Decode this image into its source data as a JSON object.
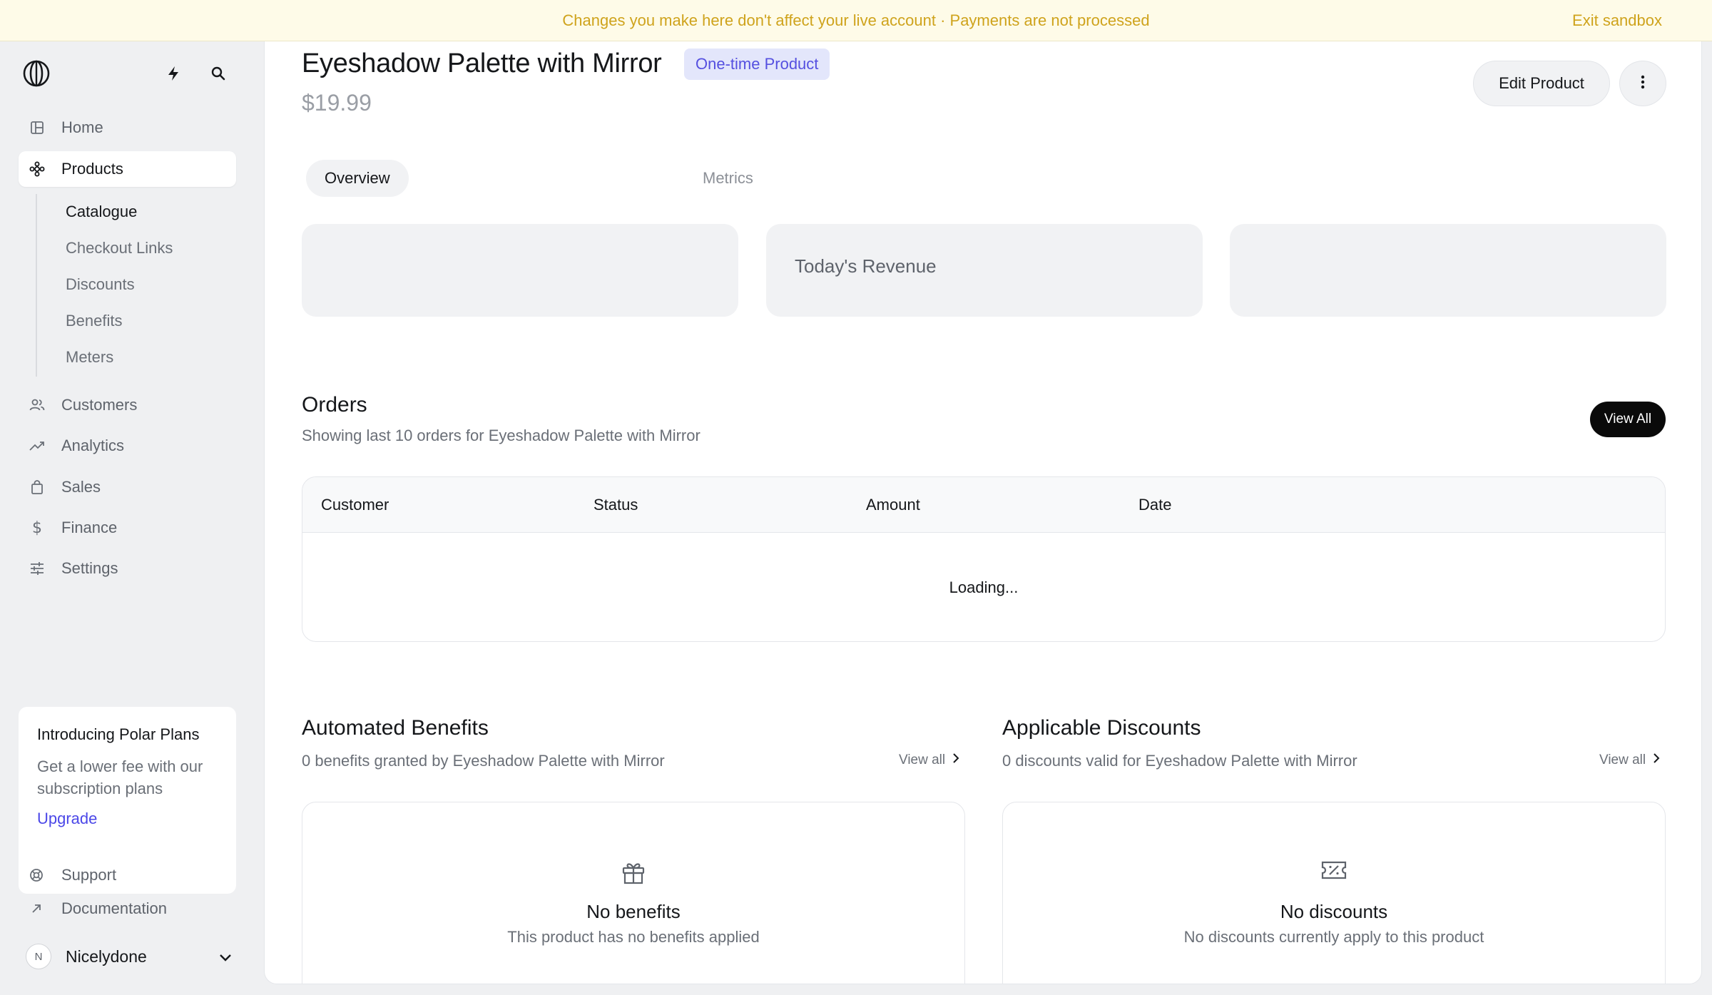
{
  "banner": {
    "message": "Changes you make here don't affect your live account · Payments are not processed",
    "exit_label": "Exit sandbox"
  },
  "sidebar": {
    "nav": [
      {
        "label": "Home",
        "icon": "home-icon"
      },
      {
        "label": "Products",
        "icon": "products-icon",
        "active": true
      },
      {
        "label": "Customers",
        "icon": "customers-icon"
      },
      {
        "label": "Analytics",
        "icon": "analytics-icon"
      },
      {
        "label": "Sales",
        "icon": "shopping-bag-icon"
      },
      {
        "label": "Finance",
        "icon": "dollar-icon"
      },
      {
        "label": "Settings",
        "icon": "sliders-icon"
      }
    ],
    "subnav": [
      {
        "label": "Catalogue",
        "active": true
      },
      {
        "label": "Checkout Links"
      },
      {
        "label": "Discounts"
      },
      {
        "label": "Benefits"
      },
      {
        "label": "Meters"
      }
    ],
    "promo": {
      "title": "Introducing Polar Plans",
      "description": "Get a lower fee with our subscription plans",
      "link": "Upgrade"
    },
    "footer_links": [
      {
        "label": "Support",
        "icon": "support-icon"
      },
      {
        "label": "Documentation",
        "icon": "external-arrow-icon"
      }
    ],
    "account": {
      "initial": "N",
      "name": "Nicelydone"
    }
  },
  "product": {
    "title": "Eyeshadow Palette with Mirror",
    "type_badge": "One-time Product",
    "price": "$19.99",
    "edit_label": "Edit Product"
  },
  "tabs": [
    {
      "label": "Overview",
      "active": true
    },
    {
      "label": "Metrics",
      "active": false
    }
  ],
  "stats": {
    "todays_revenue_label": "Today's Revenue"
  },
  "orders": {
    "title": "Orders",
    "subtitle": "Showing last 10 orders for Eyeshadow Palette with Mirror",
    "view_all_label": "View All",
    "columns": [
      "Customer",
      "Status",
      "Amount",
      "Date"
    ],
    "loading_text": "Loading..."
  },
  "benefits": {
    "title": "Automated Benefits",
    "subtitle": "0 benefits granted by Eyeshadow Palette with Mirror",
    "view_all_label": "View all",
    "empty_title": "No benefits",
    "empty_subtitle": "This product has no benefits applied"
  },
  "discounts": {
    "title": "Applicable Discounts",
    "subtitle": "0 discounts valid for Eyeshadow Palette with Mirror",
    "view_all_label": "View all",
    "empty_title": "No discounts",
    "empty_subtitle": "No discounts currently apply to this product"
  },
  "colors": {
    "accent": "#4b47e8",
    "banner_text": "#cfa31c",
    "banner_bg": "#fefbe8",
    "badge_bg": "#e3e6fb",
    "badge_text": "#5550e0"
  }
}
